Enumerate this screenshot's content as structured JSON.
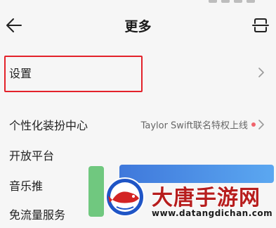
{
  "header": {
    "title": "更多"
  },
  "rows": {
    "settings": {
      "label": "设置"
    },
    "personalization": {
      "label": "个性化装扮中心",
      "subtitle": "Taylor Swift联名特权上线"
    },
    "open_platform": {
      "label": "开放平台"
    },
    "music_push": {
      "label": "音乐推"
    },
    "free_data": {
      "label": "免流量服务"
    }
  },
  "watermark": {
    "brand": "大唐手游网",
    "url": "www.datangdichan.com"
  },
  "colors": {
    "highlight_border": "#e3222a",
    "badge_dot": "#f0636c",
    "background": "#f6f6f6"
  }
}
